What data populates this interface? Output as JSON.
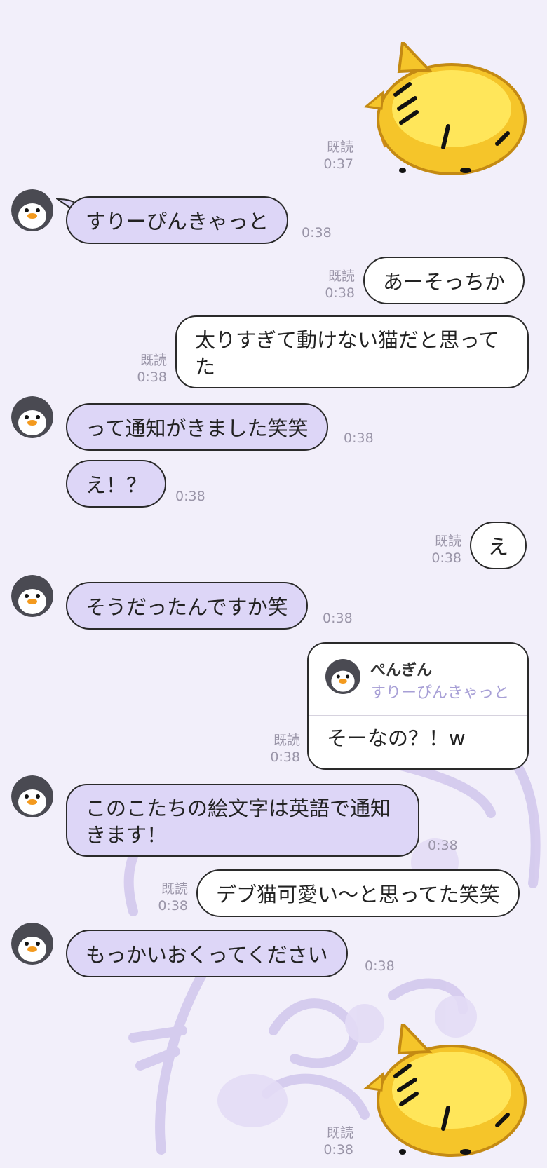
{
  "colors": {
    "background": "#f2effa",
    "incoming_bubble": "#ddd6f7",
    "outgoing_bubble": "#ffffff",
    "meta_text": "#9a95a8",
    "quote_accent": "#a79fd6"
  },
  "messages": [
    {
      "id": "m0",
      "side": "out",
      "type": "sticker",
      "sticker": "yellow-cat-sticker",
      "read": "既読",
      "time": "0:37"
    },
    {
      "id": "m1",
      "side": "in",
      "text": "すりーぴんきゃっと",
      "time": "0:38"
    },
    {
      "id": "m2",
      "side": "out",
      "text": "あーそっちか",
      "read": "既読",
      "time": "0:38"
    },
    {
      "id": "m3",
      "side": "out",
      "text": "太りすぎて動けない猫だと思ってた",
      "read": "既読",
      "time": "0:38"
    },
    {
      "id": "m4",
      "side": "in",
      "text": "って通知がきました笑笑",
      "time": "0:38"
    },
    {
      "id": "m5",
      "side": "in",
      "text": "え！？",
      "time": "0:38"
    },
    {
      "id": "m6",
      "side": "out",
      "text": "え",
      "read": "既読",
      "time": "0:38"
    },
    {
      "id": "m7",
      "side": "in",
      "text": "そうだったんですか笑",
      "time": "0:38"
    },
    {
      "id": "m8",
      "side": "out",
      "type": "reply",
      "quote_name": "ぺんぎん",
      "quote_text": "すりーぴんきゃっと",
      "text": "そーなの？！w",
      "read": "既読",
      "time": "0:38"
    },
    {
      "id": "m9",
      "side": "in",
      "text": "このこたちの絵文字は英語で通知きます！",
      "time": "0:38"
    },
    {
      "id": "m10",
      "side": "out",
      "text": "デブ猫可愛い〜と思ってた笑笑",
      "read": "既読",
      "time": "0:38"
    },
    {
      "id": "m11",
      "side": "in",
      "text": "もっかいおくってください",
      "time": "0:38"
    },
    {
      "id": "m12",
      "side": "out",
      "type": "sticker",
      "sticker": "yellow-cat-sticker",
      "read": "既読",
      "time": "0:38"
    }
  ]
}
